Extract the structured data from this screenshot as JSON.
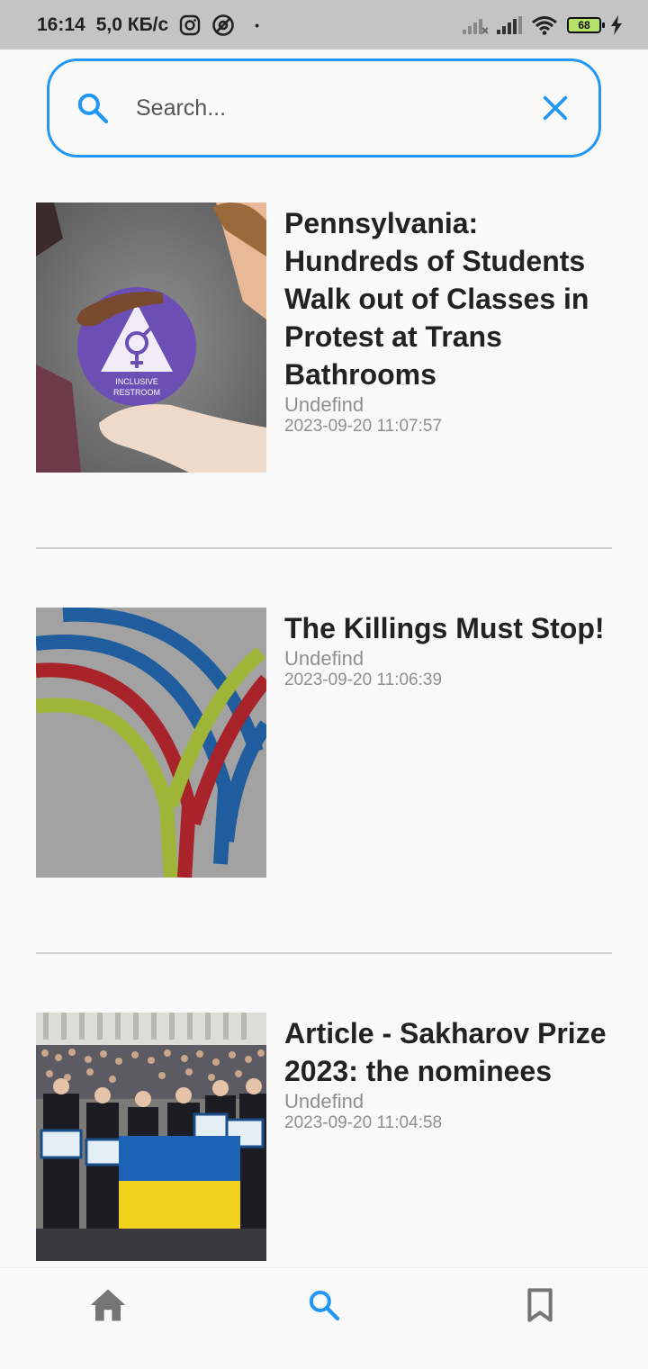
{
  "status_bar": {
    "time": "16:14",
    "speed": "5,0 КБ/с",
    "dot": "•",
    "battery": "68",
    "icons": [
      "instagram-icon",
      "at-icon",
      "signal-icon",
      "signal-icon",
      "wifi-icon",
      "battery-icon",
      "charging-icon"
    ]
  },
  "search": {
    "placeholder": "Search...",
    "value": "",
    "accent_color": "#2196f3",
    "icons": [
      "search-icon",
      "close-icon"
    ]
  },
  "articles": [
    {
      "title": "Pennsylvania: Hundreds of Students Walk out of Classes in Protest at Trans Bathrooms",
      "source": "Undefind",
      "date": "2023-09-20 11:07:57",
      "image_text": "INCLUSIVE RESTROOM"
    },
    {
      "title": "The Killings Must Stop!",
      "source": "Undefind",
      "date": "2023-09-20 11:06:39"
    },
    {
      "title": "Article - Sakharov Prize 2023: the nominees",
      "source": "Undefind",
      "date": "2023-09-20 11:04:58"
    }
  ],
  "bottom_nav": {
    "items": [
      {
        "icon": "home-icon",
        "active": false
      },
      {
        "icon": "search-icon",
        "active": true
      },
      {
        "icon": "bookmark-icon",
        "active": false
      }
    ],
    "active_color": "#2196f3",
    "inactive_color": "#757575"
  }
}
